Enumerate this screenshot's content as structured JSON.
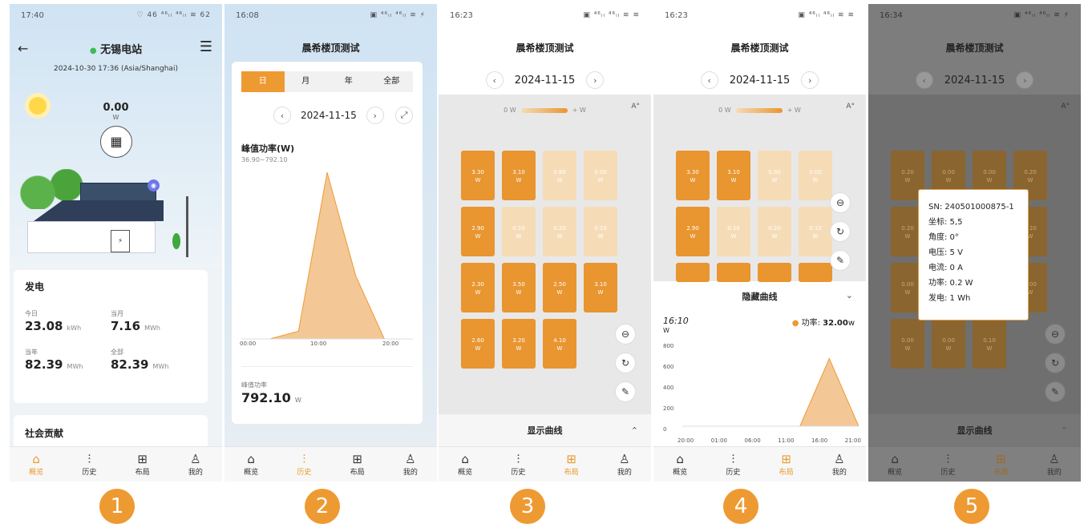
{
  "screens": [
    {
      "status": {
        "time": "17:40",
        "icons": "♡ 46 ⁴⁶ᵢₗ ⁴⁶ᵢₗ ≋ 62"
      },
      "station_name": "无锡电站",
      "datetime": "2024-10-30 17:36 (Asia/Shanghai)",
      "power_value": "0.00",
      "power_unit": "W",
      "gen_title": "发电",
      "stats": [
        {
          "label": "今日",
          "value": "23.08",
          "unit": "kWh"
        },
        {
          "label": "当月",
          "value": "7.16",
          "unit": "MWh"
        },
        {
          "label": "当年",
          "value": "82.39",
          "unit": "MWh"
        },
        {
          "label": "全部",
          "value": "82.39",
          "unit": "MWh"
        }
      ],
      "social_title": "社会贡献",
      "nav": [
        "概览",
        "历史",
        "布局",
        "我的"
      ],
      "badge": "1"
    },
    {
      "status": {
        "time": "16:08",
        "icons": "▣ ⁴⁶ᵢₗ ⁴⁶ᵢₗ ≋ ⚡"
      },
      "title": "晨希楼顶测试",
      "tabs": [
        "日",
        "月",
        "年",
        "全部"
      ],
      "date": "2024-11-15",
      "peak_title": "峰值功率(W)",
      "peak_range": "36.90~792.10",
      "x_ticks": [
        "00:00",
        "10:00",
        "20:00"
      ],
      "peak_label": "峰值功率",
      "peak_value": "792.10",
      "peak_unit": "W",
      "nav": [
        "概览",
        "历史",
        "布局",
        "我的"
      ],
      "badge": "2"
    },
    {
      "status": {
        "time": "16:23",
        "icons": "▣ ⁴⁶ᵢₗ ⁴⁶ᵢₗ ≋ ≋"
      },
      "title": "晨希楼顶测试",
      "date": "2024-11-15",
      "legend_left": "0 W",
      "legend_right": "+ W",
      "auto_icon": "A°",
      "panels": [
        "3.30",
        "3.10",
        "0.80",
        "0.00",
        "2.90",
        "0.10",
        "0.20",
        "0.10",
        "2.30",
        "3.50",
        "2.50",
        "3.10",
        "2.60",
        "3.20",
        "4.10"
      ],
      "panel_unit": "W",
      "show_curve": "显示曲线",
      "nav": [
        "概览",
        "历史",
        "布局",
        "我的"
      ],
      "badge": "3"
    },
    {
      "status": {
        "time": "16:23",
        "icons": "▣ ⁴⁶ᵢₗ ⁴⁶ᵢₗ ≋ ≋"
      },
      "title": "晨希楼顶测试",
      "date": "2024-11-15",
      "legend_left": "0 W",
      "legend_right": "+ W",
      "auto_icon": "A°",
      "panels": [
        "3.30",
        "3.10",
        "0.80",
        "0.00",
        "2.90",
        "0.10",
        "0.20",
        "0.10"
      ],
      "panel_unit": "W",
      "hide_curve": "隐藏曲线",
      "curve_time": "16:10",
      "curve_series": "功率",
      "curve_value": "32.00",
      "curve_unit": "w",
      "y_unit": "W",
      "y_ticks": [
        "800",
        "600",
        "400",
        "200",
        "0"
      ],
      "x_ticks": [
        "20:00",
        "01:00",
        "06:00",
        "11:00",
        "16:00",
        "21:00"
      ],
      "nav": [
        "概览",
        "历史",
        "布局",
        "我的"
      ],
      "badge": "4"
    },
    {
      "status": {
        "time": "16:34",
        "icons": "▣ ⁴⁶ᵢₗ ⁴⁶ᵢₗ ≋ ⚡"
      },
      "title": "晨希楼顶测试",
      "date": "2024-11-15",
      "auto_icon": "A°",
      "panels": [
        "0.20",
        "0.00",
        "0.00",
        "0.20",
        "0.20",
        "",
        "",
        "0.20",
        "0.00",
        "",
        "",
        "0.00",
        "0.00",
        "0.00",
        "0.10"
      ],
      "panel_unit": "W",
      "popup": [
        "SN: 240501000875-1",
        "坐标: 5,5",
        "角度: 0°",
        "电压: 5 V",
        "电流: 0 A",
        "功率: 0.2 W",
        "发电: 1 Wh"
      ],
      "show_curve": "显示曲线",
      "nav": [
        "概览",
        "历史",
        "布局",
        "我的"
      ],
      "badge": "5"
    }
  ],
  "colors": {
    "accent": "#ee9a32",
    "panel_high": "#e99530",
    "panel_low": "#f5dcb6",
    "dim": "#7d7d7d"
  },
  "icons": {
    "back": "back-arrow-icon",
    "menu": "hamburger-menu-icon",
    "home": "home-icon",
    "history": "history-chart-icon",
    "layout": "grid-layout-icon",
    "profile": "person-icon",
    "zoom_out": "zoom-out-icon",
    "rotate": "rotate-icon",
    "edit": "edit-icon",
    "expand": "expand-icon",
    "prev": "chevron-left-icon",
    "next": "chevron-right-icon"
  },
  "chart_data": [
    {
      "type": "area",
      "title": "峰值功率(W)",
      "x": [
        "00:00",
        "10:00",
        "20:00"
      ],
      "series": [
        {
          "values": [
            0,
            0,
            36.9,
            792.1,
            300,
            0,
            0
          ]
        }
      ],
      "ylim": [
        0,
        800
      ]
    },
    {
      "type": "area",
      "ylabel": "W",
      "x": [
        "20:00",
        "01:00",
        "06:00",
        "11:00",
        "16:00",
        "21:00"
      ],
      "series": [
        {
          "name": "功率",
          "values": [
            0,
            0,
            0,
            0,
            0,
            650,
            0
          ]
        }
      ],
      "ylim": [
        0,
        800
      ]
    }
  ]
}
